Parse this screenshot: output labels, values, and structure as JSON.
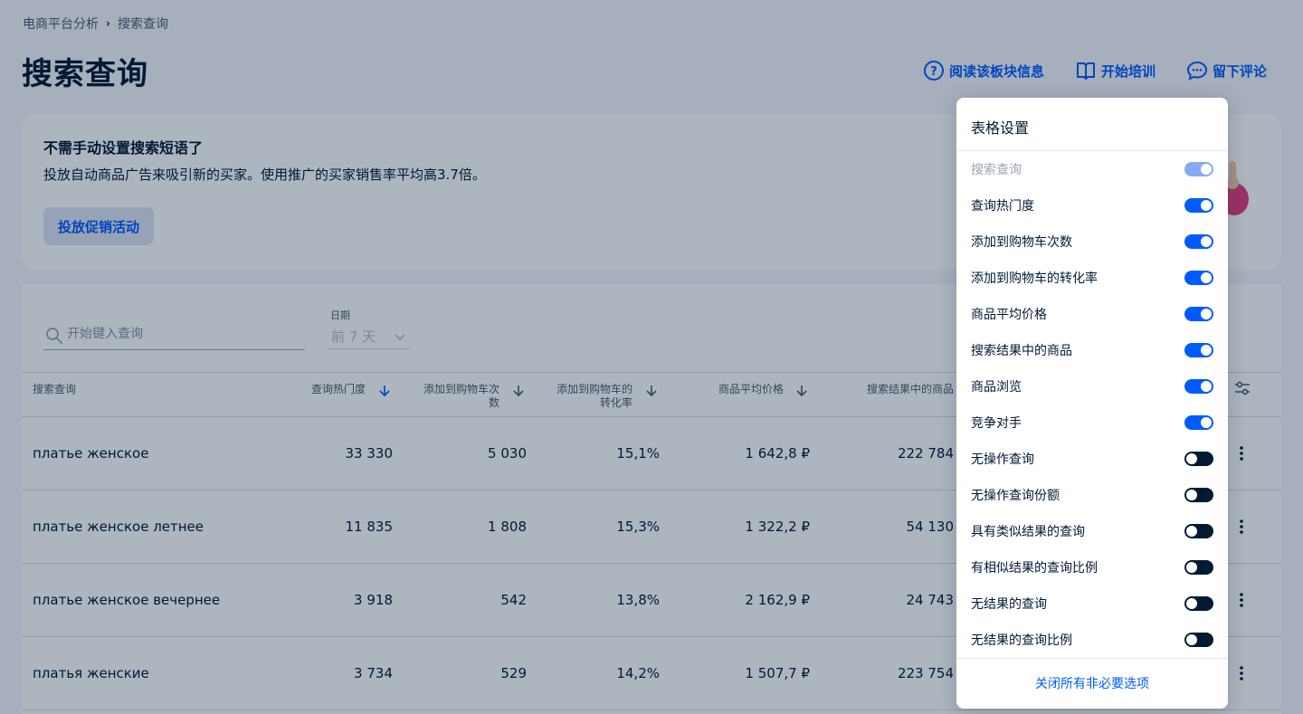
{
  "breadcrumb": {
    "parent": "电商平台分析",
    "current": "搜索查询"
  },
  "page": {
    "title": "搜索查询"
  },
  "top_actions": [
    {
      "label": "阅读该板块信息",
      "icon": "help-circle-icon"
    },
    {
      "label": "开始培训",
      "icon": "book-icon"
    },
    {
      "label": "留下评论",
      "icon": "chat-icon"
    }
  ],
  "promo": {
    "title": "不需手动设置搜索短语了",
    "text": "投放自动商品广告来吸引新的买家。使用推广的买家销售率平均高3.7倍。",
    "button": "投放促销活动"
  },
  "search": {
    "placeholder": "开始键入查询"
  },
  "date": {
    "label": "日期",
    "value": "前 7 天"
  },
  "columns": {
    "query": "搜索查询",
    "popularity": "查询热门度",
    "cart_adds_1": "添加到购物车次",
    "cart_adds_2": "数",
    "cart_conv_1": "添加到购物车的",
    "cart_conv_2": "转化率",
    "avg_price": "商品平均价格",
    "products_in_results": "搜索结果中的商品"
  },
  "rows": [
    {
      "query": "платье женское",
      "popularity": "33 330",
      "cart_adds": "5 030",
      "conversion": "15,1%",
      "avg_price": "1 642,8 ₽",
      "products": "222 784"
    },
    {
      "query": "платье женское летнее",
      "popularity": "11 835",
      "cart_adds": "1 808",
      "conversion": "15,3%",
      "avg_price": "1 322,2 ₽",
      "products": "54 130"
    },
    {
      "query": "платье женское вечернее",
      "popularity": "3 918",
      "cart_adds": "542",
      "conversion": "13,8%",
      "avg_price": "2 162,9 ₽",
      "products": "24 743"
    },
    {
      "query": "платья женские",
      "popularity": "3 734",
      "cart_adds": "529",
      "conversion": "14,2%",
      "avg_price": "1 507,7 ₽",
      "products": "223 754"
    }
  ],
  "settings": {
    "title": "表格设置",
    "options": [
      {
        "label": "搜索查询",
        "on": true,
        "disabled": true
      },
      {
        "label": "查询热门度",
        "on": true
      },
      {
        "label": "添加到购物车次数",
        "on": true
      },
      {
        "label": "添加到购物车的转化率",
        "on": true
      },
      {
        "label": "商品平均价格",
        "on": true
      },
      {
        "label": "搜索结果中的商品",
        "on": true
      },
      {
        "label": "商品浏览",
        "on": true
      },
      {
        "label": "竞争对手",
        "on": true
      },
      {
        "label": "无操作查询",
        "on": false
      },
      {
        "label": "无操作查询份额",
        "on": false
      },
      {
        "label": "具有类似结果的查询",
        "on": false
      },
      {
        "label": "有相似结果的查询比例",
        "on": false
      },
      {
        "label": "无结果的查询",
        "on": false
      },
      {
        "label": "无结果的查询比例",
        "on": false
      }
    ],
    "footer": "关闭所有非必要选项"
  },
  "colors": {
    "accent": "#005bff",
    "text": "#001a34",
    "overlay": "rgba(0,26,52,0.32)"
  }
}
